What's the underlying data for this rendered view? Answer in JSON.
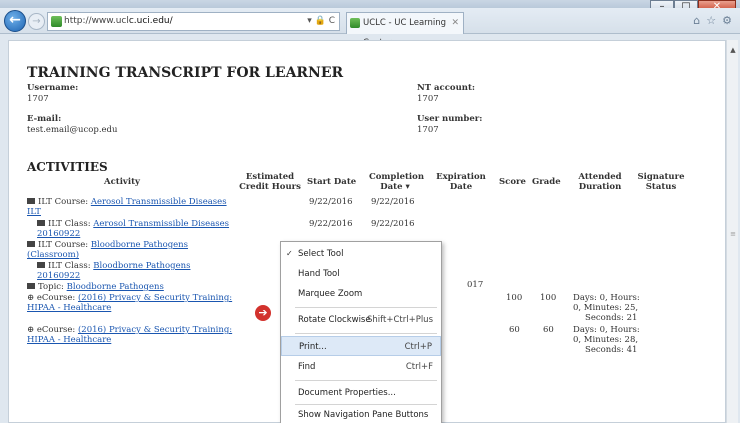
{
  "window": {
    "min": "–",
    "max": "□",
    "close": "✕"
  },
  "browser": {
    "url_prefix": "http://www.ucl",
    "url_domain": "c.uci.edu/",
    "addr_icons": "▾ 🔒 C",
    "tab_title": "UCLC - UC Learning Center...",
    "tab_close": "✕",
    "icons": [
      "home-icon",
      "star-icon",
      "gear-icon"
    ]
  },
  "page": {
    "title": "TRAINING TRANSCRIPT FOR LEARNER",
    "username_label": "Username:",
    "username": "1707",
    "email_label": "E-mail:",
    "email": "test.email@ucop.edu",
    "nt_label": "NT account:",
    "nt_account": "1707",
    "usernum_label": "User number:",
    "user_number": "1707"
  },
  "activities": {
    "title": "ACTIVITIES",
    "headers": {
      "activity": "Activity",
      "credit_1": "Estimated",
      "credit_2": "Credit Hours",
      "start": "Start Date",
      "completion_1": "Completion",
      "completion_2": "Date ▾",
      "expiration_1": "Expiration",
      "expiration_2": "Date",
      "score": "Score",
      "grade": "Grade",
      "attended_1": "Attended",
      "attended_2": "Duration",
      "signature_1": "Signature",
      "signature_2": "Status"
    },
    "rows": [
      {
        "prefix": "ILT Course: ",
        "link_1": "Aerosol Transmissible Diseases",
        "link_2": "ILT",
        "start": "9/22/2016",
        "completion": "9/22/2016"
      },
      {
        "prefix": "ILT Class: ",
        "link_1": "Aerosol Transmissible Diseases",
        "link_2": "20160922",
        "start": "9/22/2016",
        "completion": "9/22/2016"
      },
      {
        "prefix": "ILT Course: ",
        "link_1": "Bloodborne Pathogens",
        "link_2": "(Classroom)"
      },
      {
        "prefix": "ILT Class: ",
        "link_1": "Bloodborne Pathogens",
        "link_2": "20160922"
      },
      {
        "prefix": "Topic: ",
        "link_1": "Bloodborne Pathogens",
        "expiration": "017"
      },
      {
        "prefix": "eCourse: ",
        "link_1": "(2016) Privacy & Security Training:",
        "link_2": "HIPAA - Healthcare",
        "score": "100",
        "grade": "100",
        "attended_1": "Days: 0, Hours:",
        "attended_2": "0, Minutes: 25,",
        "attended_3": "Seconds: 21"
      },
      {
        "prefix": "eCourse: ",
        "link_1": "(2016) Privacy & Security Training:",
        "link_2": "HIPAA - Healthcare",
        "score": "60",
        "grade": "60",
        "attended_1": "Days: 0, Hours:",
        "attended_2": "0, Minutes: 28,",
        "attended_3": "Seconds: 41"
      }
    ]
  },
  "context_menu": {
    "check": "✓",
    "items": [
      {
        "label": "Select Tool",
        "shortcut": ""
      },
      {
        "label": "Hand Tool",
        "shortcut": ""
      },
      {
        "label": "Marquee Zoom",
        "shortcut": ""
      },
      {
        "label": "Rotate Clockwise",
        "shortcut": "Shift+Ctrl+Plus"
      },
      {
        "label": "Print...",
        "shortcut": "Ctrl+P"
      },
      {
        "label": "Find",
        "shortcut": "Ctrl+F"
      },
      {
        "label": "Document Properties...",
        "shortcut": ""
      },
      {
        "label": "Show Navigation Pane Buttons",
        "shortcut": ""
      }
    ]
  },
  "arrow_badge": "➔"
}
